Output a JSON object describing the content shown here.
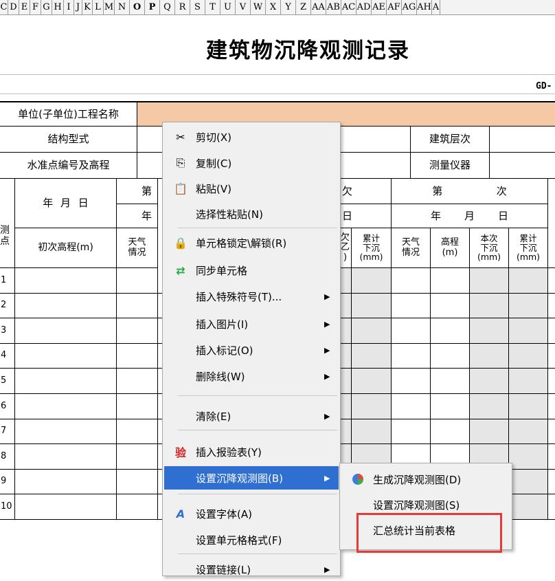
{
  "columns": [
    "C",
    "D",
    "E",
    "F",
    "G",
    "H",
    "I",
    "J",
    "K",
    "L",
    "M",
    "N",
    "O",
    "P",
    "Q",
    "R",
    "S",
    "T",
    "U",
    "V",
    "W",
    "X",
    "Y",
    "Z",
    "AA",
    "AB",
    "AC",
    "AD",
    "AE",
    "AF",
    "AG",
    "AH",
    "A"
  ],
  "sheet": {
    "title": "建筑物沉降观测记录",
    "code": "GD-",
    "project_label": "单位(子单位)工程名称",
    "structure_label": "结构型式",
    "benchmark_label": "水准点编号及高程",
    "floors_label": "建筑层次",
    "instrument_label": "测量仪器",
    "date_label": "年  月  日",
    "point_label": "测\n点",
    "initial_elev": "初次高程(m)",
    "weather": "天气\n情况",
    "elev": "高程\n(m)",
    "this_settle": "本次\n下沉\n(mm)",
    "cum_settle": "累计\n下沉\n(mm)",
    "di": "第",
    "ci": "次",
    "nian": "年",
    "yue": "月",
    "ri": "日",
    "ci_partial": "欠",
    "ri_partial": "日",
    "frag_cum": "累计\n下沉\n(mm)",
    "frag_settle": "欠\n乙\n)",
    "rows": [
      "1",
      "2",
      "3",
      "4",
      "5",
      "6",
      "7",
      "8",
      "9",
      "10"
    ]
  },
  "menu": {
    "items": [
      {
        "label": "剪切(X)",
        "icon": "scissors-icon",
        "glyph": "✂"
      },
      {
        "label": "复制(C)",
        "icon": "copy-icon",
        "glyph": "⎘"
      },
      {
        "label": "粘贴(V)",
        "icon": "paste-icon",
        "glyph": "📋"
      },
      {
        "label": "选择性粘贴(N)"
      },
      {
        "label": "单元格锁定\\解锁(R)",
        "icon": "lock-icon",
        "glyph": "🔒"
      },
      {
        "label": "同步单元格",
        "icon": "sync-icon",
        "glyph": "⇄"
      },
      {
        "label": "插入特殊符号(T)...",
        "arrow": "▶"
      },
      {
        "label": "插入图片(I)",
        "arrow": "▶"
      },
      {
        "label": "插入标记(O)",
        "arrow": "▶"
      },
      {
        "label": "删除线(W)",
        "arrow": "▶"
      },
      {
        "label": "清除(E)",
        "arrow": "▶"
      },
      {
        "label": "插入报验表(Y)",
        "icon": "inspection-icon",
        "glyph": "验"
      },
      {
        "label": "设置沉降观测图(B)",
        "arrow": "▶"
      },
      {
        "label": "设置字体(A)",
        "icon": "font-icon",
        "glyph": "A"
      },
      {
        "label": "设置单元格格式(F)"
      },
      {
        "label": "设置链接(L)",
        "arrow": "▶"
      }
    ]
  },
  "submenu": {
    "items": [
      {
        "label": "生成沉降观测图(D)",
        "icon": "pie-chart-icon"
      },
      {
        "label": "设置沉降观测图(S)"
      },
      {
        "label": "汇总统计当前表格"
      }
    ]
  },
  "colors": {
    "highlight": "#2f6fd1",
    "annotation": "#e53a3a",
    "orange": "#f6c9a6"
  }
}
